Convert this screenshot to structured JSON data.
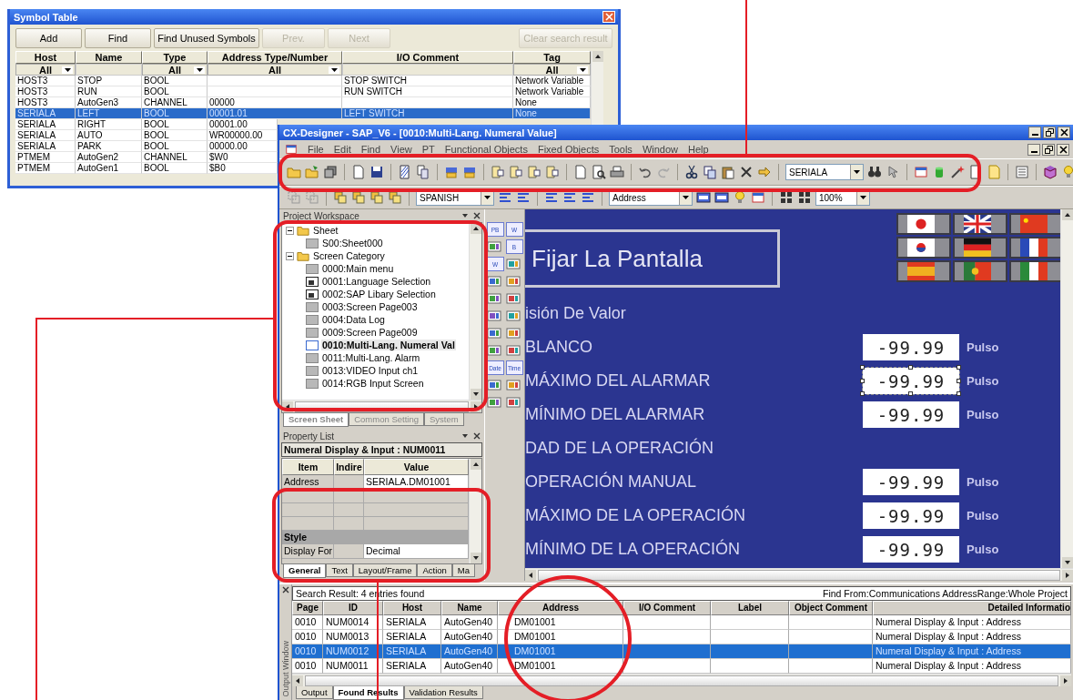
{
  "symbol_table": {
    "title": "Symbol Table",
    "buttons": [
      {
        "label": "Add",
        "disabled": false
      },
      {
        "label": "Find",
        "disabled": false
      },
      {
        "label": "Find Unused Symbols",
        "disabled": false
      },
      {
        "label": "Prev.",
        "disabled": true
      },
      {
        "label": "Next",
        "disabled": true
      },
      {
        "label": "Clear search result",
        "disabled": true
      }
    ],
    "columns": [
      "Host",
      "Name",
      "Type",
      "Address Type/Number",
      "I/O Comment",
      "Tag"
    ],
    "filters": [
      {
        "kind": "dropdown",
        "value": "All"
      },
      {
        "kind": "blank"
      },
      {
        "kind": "dropdown",
        "value": "All"
      },
      {
        "kind": "dropdown",
        "value": "All"
      },
      {
        "kind": "blank"
      },
      {
        "kind": "dropdown",
        "value": "All"
      }
    ],
    "rows": [
      {
        "selected": false,
        "cells": [
          "HOST3",
          "STOP",
          "BOOL",
          null,
          "STOP SWITCH",
          "Network Variable"
        ]
      },
      {
        "selected": false,
        "cells": [
          "HOST3",
          "RUN",
          "BOOL",
          null,
          "RUN SWITCH",
          "Network Variable"
        ]
      },
      {
        "selected": false,
        "cells": [
          "HOST3",
          "AutoGen3",
          "CHANNEL",
          "00000",
          null,
          "None"
        ]
      },
      {
        "selected": true,
        "cells": [
          "SERIALA",
          "LEFT",
          "BOOL",
          "00001.01",
          "LEFT SWITCH",
          "None"
        ]
      },
      {
        "selected": false,
        "cells": [
          "SERIALA",
          "RIGHT",
          "BOOL",
          "00001.00"
        ]
      },
      {
        "selected": false,
        "cells": [
          "SERIALA",
          "AUTO",
          "BOOL",
          "WR00000.00"
        ]
      },
      {
        "selected": false,
        "cells": [
          "SERIALA",
          "PARK",
          "BOOL",
          "00000.00"
        ]
      },
      {
        "selected": false,
        "cells": [
          "PTMEM",
          "AutoGen2",
          "CHANNEL",
          "$W0"
        ]
      },
      {
        "selected": false,
        "cells": [
          "PTMEM",
          "AutoGen1",
          "BOOL",
          "$B0"
        ]
      }
    ]
  },
  "cx_designer": {
    "title": "CX-Designer - SAP_V6 - [0010:Multi-Lang. Numeral Value]",
    "menu": [
      "File",
      "Edit",
      "Find",
      "View",
      "PT",
      "Functional Objects",
      "Fixed Objects",
      "Tools",
      "Window",
      "Help"
    ],
    "toolbar_combo": "SERIALA",
    "toolbar2_combos": [
      "SPANISH",
      "Address",
      "100%"
    ],
    "workspace": {
      "title": "Project Workspace",
      "tree": [
        {
          "label": "Sheet",
          "kind": "folder",
          "expanded": true,
          "selected": false,
          "children": [
            {
              "label": "S00:Sheet000",
              "kind": "screen",
              "selected": false
            }
          ]
        },
        {
          "label": "Screen Category",
          "kind": "folder",
          "expanded": true,
          "selected": false,
          "children": [
            {
              "label": "0000:Main menu",
              "kind": "screen",
              "selected": false
            },
            {
              "label": "0001:Language Selection",
              "kind": "popup",
              "selected": false
            },
            {
              "label": "0002:SAP Libary Selection",
              "kind": "popup",
              "selected": false
            },
            {
              "label": "0003:Screen Page003",
              "kind": "screen",
              "selected": false
            },
            {
              "label": "0004:Data Log",
              "kind": "screen",
              "selected": false
            },
            {
              "label": "0009:Screen Page009",
              "kind": "screen",
              "selected": false
            },
            {
              "label": "0010:Multi-Lang. Numeral Val",
              "kind": "screen",
              "selected": true
            },
            {
              "label": "0011:Multi-Lang. Alarm",
              "kind": "screen",
              "selected": false
            },
            {
              "label": "0013:VIDEO Input ch1",
              "kind": "screen",
              "selected": false
            },
            {
              "label": "0014:RGB Input Screen",
              "kind": "screen",
              "selected": false
            }
          ]
        }
      ],
      "tabs": [
        {
          "label": "Screen Sheet",
          "selected": true
        },
        {
          "label": "Common Setting",
          "selected": false
        },
        {
          "label": "System",
          "selected": false
        }
      ]
    },
    "toolbox": [
      {
        "kind": "label",
        "text": "PB"
      },
      {
        "kind": "label",
        "text": "W"
      },
      {
        "kind": "graphic"
      },
      {
        "kind": "label",
        "text": "B"
      },
      {
        "kind": "label",
        "text": "W"
      },
      {
        "kind": "graphic"
      },
      {
        "kind": "graphic"
      },
      {
        "kind": "graphic"
      },
      {
        "kind": "graphic"
      },
      {
        "kind": "graphic"
      },
      {
        "kind": "graphic"
      },
      {
        "kind": "graphic"
      },
      {
        "kind": "graphic"
      },
      {
        "kind": "graphic"
      },
      {
        "kind": "graphic"
      },
      {
        "kind": "graphic"
      },
      {
        "kind": "label",
        "text": "Date"
      },
      {
        "kind": "label",
        "text": "Time"
      },
      {
        "kind": "graphic"
      },
      {
        "kind": "graphic"
      },
      {
        "kind": "graphic"
      },
      {
        "kind": "graphic"
      }
    ],
    "property_list": {
      "title": "Property List",
      "object": "Numeral Display & Input : NUM0011",
      "columns": [
        "Item",
        "Indire",
        "Value"
      ],
      "rows": [
        {
          "kind": "property",
          "item": "Address",
          "value": "SERIALA.DM01001"
        },
        {
          "kind": "blank"
        },
        {
          "kind": "blank"
        },
        {
          "kind": "blank"
        },
        {
          "kind": "group",
          "label": "Style"
        },
        {
          "kind": "property",
          "item": "Display For",
          "value": "Decimal"
        }
      ],
      "tabs": [
        {
          "label": "General",
          "selected": true
        },
        {
          "label": "Text",
          "selected": false
        },
        {
          "label": "Layout/Frame",
          "selected": false
        },
        {
          "label": "Action",
          "selected": false
        },
        {
          "label": "Ma",
          "selected": false
        }
      ]
    },
    "screen": {
      "title": "Fijar La Pantalla",
      "flags": [
        {
          "kind": "japan"
        },
        {
          "kind": "uk"
        },
        {
          "kind": "china"
        },
        {
          "kind": "korea"
        },
        {
          "kind": "germany"
        },
        {
          "kind": "france"
        },
        {
          "kind": "spain"
        },
        {
          "kind": "portugal"
        },
        {
          "kind": "italy"
        }
      ],
      "rows": [
        {
          "kind": "heading",
          "label": "isión De Valor"
        },
        {
          "kind": "value",
          "label": "BLANCO",
          "value": "-99.99",
          "unit": "Pulso",
          "selected": false
        },
        {
          "kind": "value",
          "label": "MÁXIMO DEL ALARMAR",
          "value": "-99.99",
          "unit": "Pulso",
          "selected": true
        },
        {
          "kind": "value",
          "label": "MÍNIMO DEL ALARMAR",
          "value": "-99.99",
          "unit": "Pulso",
          "selected": false
        },
        {
          "kind": "heading",
          "label": "DAD DE LA OPERACIÓN"
        },
        {
          "kind": "value",
          "label": "OPERACIÓN MANUAL",
          "value": "-99.99",
          "unit": "Pulso",
          "selected": false
        },
        {
          "kind": "value",
          "label": "MÁXIMO DE LA OPERACIÓN",
          "value": "-99.99",
          "unit": "Pulso",
          "selected": false
        },
        {
          "kind": "value",
          "label": "MÍNIMO DE LA OPERACIÓN",
          "value": "-99.99",
          "unit": "Pulso",
          "selected": false
        }
      ]
    },
    "output": {
      "title": "Output Window",
      "summary": "Search Result: 4 entries found",
      "scope": "Find From:Communications AddressRange:Whole Project",
      "columns": [
        "Page",
        "ID",
        "Host",
        "Name",
        "Address",
        "I/O Comment",
        "Label",
        "Object Comment",
        "Detailed Informatio"
      ],
      "rows": [
        {
          "selected": false,
          "cells": [
            "0010",
            "NUM0014",
            "SERIALA",
            "AutoGen40",
            "DM01001",
            null,
            null,
            null,
            "Numeral Display & Input : Address"
          ]
        },
        {
          "selected": false,
          "cells": [
            "0010",
            "NUM0013",
            "SERIALA",
            "AutoGen40",
            "DM01001",
            null,
            null,
            null,
            "Numeral Display & Input : Address"
          ]
        },
        {
          "selected": true,
          "cells": [
            "0010",
            "NUM0012",
            "SERIALA",
            "AutoGen40",
            "DM01001",
            null,
            null,
            null,
            "Numeral Display & Input : Address"
          ]
        },
        {
          "selected": false,
          "cells": [
            "0010",
            "NUM0011",
            "SERIALA",
            "AutoGen40",
            "DM01001",
            null,
            null,
            null,
            "Numeral Display & Input : Address"
          ]
        }
      ],
      "tabs": [
        {
          "label": "Output",
          "selected": false
        },
        {
          "label": "Found Results",
          "selected": true
        },
        {
          "label": "Validation Results",
          "selected": false
        }
      ]
    }
  }
}
